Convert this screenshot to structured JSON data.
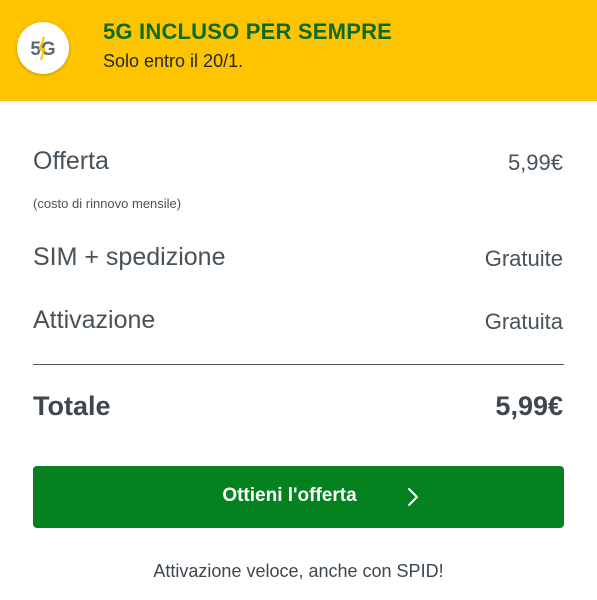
{
  "banner": {
    "badge_icon": "5g-badge-icon",
    "badge_text": "5G",
    "title": "5G INCLUSO PER SEMPRE",
    "subtitle": "Solo entro il 20/1.",
    "background_color": "#ffc400",
    "title_color": "#0b6b1f"
  },
  "summary": {
    "offer": {
      "label": "Offerta",
      "value": "5,99€",
      "note": "(costo di rinnovo mensile)"
    },
    "sim": {
      "label": "SIM + spedizione",
      "value": "Gratuite"
    },
    "activation": {
      "label": "Attivazione",
      "value": "Gratuita"
    },
    "total": {
      "label": "Totale",
      "value": "5,99€"
    }
  },
  "cta": {
    "label": "Ottieni l'offerta",
    "icon": "chevron-right-icon",
    "color": "#05821f"
  },
  "footer": {
    "note": "Attivazione veloce, anche con SPID!"
  }
}
